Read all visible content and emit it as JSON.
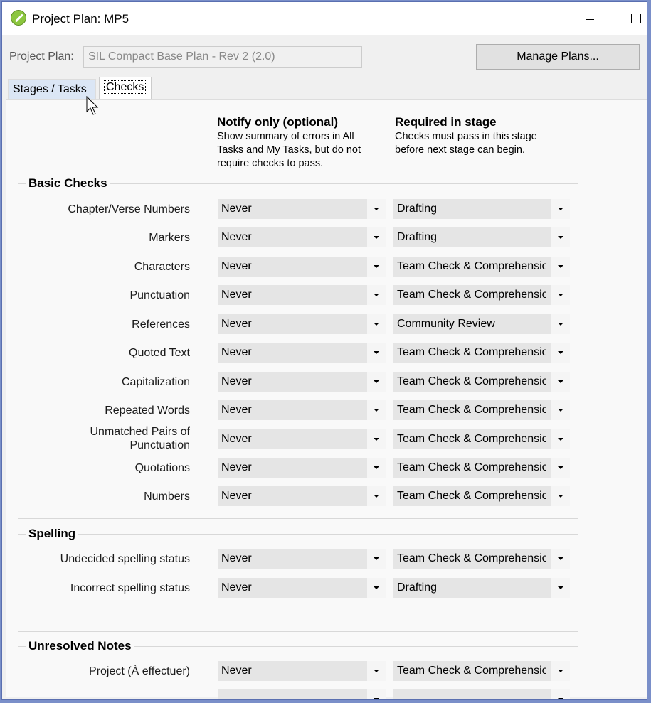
{
  "window": {
    "title": "Project Plan: MP5"
  },
  "plan": {
    "label": "Project Plan:",
    "value": "SIL Compact Base Plan - Rev 2 (2.0)",
    "manage_label": "Manage Plans..."
  },
  "tabs": [
    {
      "label": "Stages / Tasks"
    },
    {
      "label": "Checks"
    }
  ],
  "columns": {
    "notify": {
      "title": "Notify only (optional)",
      "desc1": "Show summary of errors in All",
      "desc2": "Tasks and My Tasks, but do not",
      "desc3": "require checks to pass."
    },
    "required": {
      "title": "Required in stage",
      "desc1": "Checks must pass in this stage",
      "desc2": "before next stage can begin."
    }
  },
  "groups": {
    "basic": {
      "title": "Basic Checks",
      "rows": [
        {
          "label": "Chapter/Verse Numbers",
          "notify": "Never",
          "required": "Drafting"
        },
        {
          "label": "Markers",
          "notify": "Never",
          "required": "Drafting"
        },
        {
          "label": "Characters",
          "notify": "Never",
          "required": "Team Check & Comprehension"
        },
        {
          "label": "Punctuation",
          "notify": "Never",
          "required": "Team Check & Comprehension"
        },
        {
          "label": "References",
          "notify": "Never",
          "required": "Community Review"
        },
        {
          "label": "Quoted Text",
          "notify": "Never",
          "required": "Team Check & Comprehension"
        },
        {
          "label": "Capitalization",
          "notify": "Never",
          "required": "Team Check & Comprehension"
        },
        {
          "label": "Repeated Words",
          "notify": "Never",
          "required": "Team Check & Comprehension"
        },
        {
          "label": "Unmatched Pairs of",
          "label2": "Punctuation",
          "notify": "Never",
          "required": "Team Check & Comprehension"
        },
        {
          "label": "Quotations",
          "notify": "Never",
          "required": "Team Check & Comprehension"
        },
        {
          "label": "Numbers",
          "notify": "Never",
          "required": "Team Check & Comprehension"
        }
      ]
    },
    "spelling": {
      "title": "Spelling",
      "rows": [
        {
          "label": "Undecided spelling status",
          "notify": "Never",
          "required": "Team Check & Comprehension"
        },
        {
          "label": "Incorrect spelling status",
          "notify": "Never",
          "required": "Drafting"
        }
      ]
    },
    "notes": {
      "title": "Unresolved Notes",
      "rows": [
        {
          "label": "Project (À effectuer)",
          "notify": "Never",
          "required": "Team Check & Comprehension"
        }
      ]
    }
  }
}
